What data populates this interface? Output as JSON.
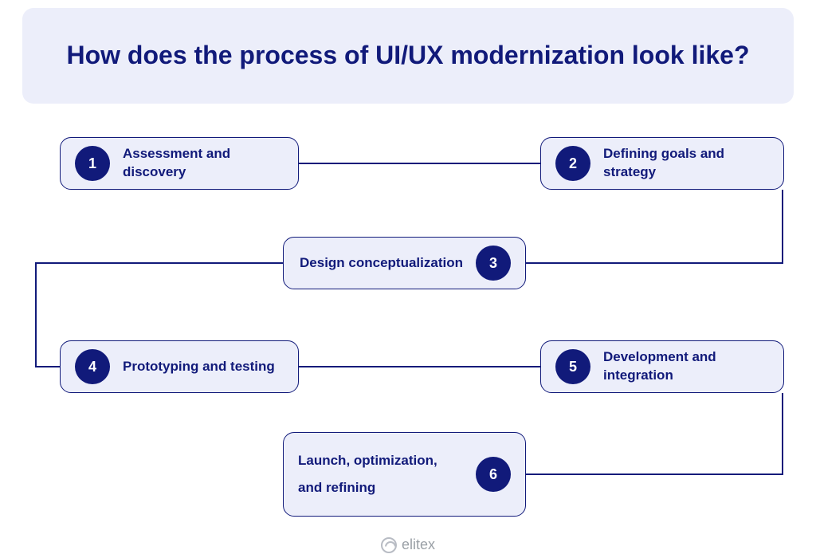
{
  "title": "How does the process of UI/UX modernization look like?",
  "steps": {
    "s1": {
      "num": "1",
      "label": "Assessment and discovery"
    },
    "s2": {
      "num": "2",
      "label": "Defining goals and strategy"
    },
    "s3": {
      "num": "3",
      "label": "Design conceptualization"
    },
    "s4": {
      "num": "4",
      "label": "Prototyping and testing"
    },
    "s5": {
      "num": "5",
      "label": "Development and integration"
    },
    "s6": {
      "num": "6",
      "label": "Launch, optimization, and refining"
    }
  },
  "brand": "elitex",
  "colors": {
    "primary": "#111a7a",
    "box_bg": "#eceefa",
    "page_bg": "#ffffff"
  }
}
